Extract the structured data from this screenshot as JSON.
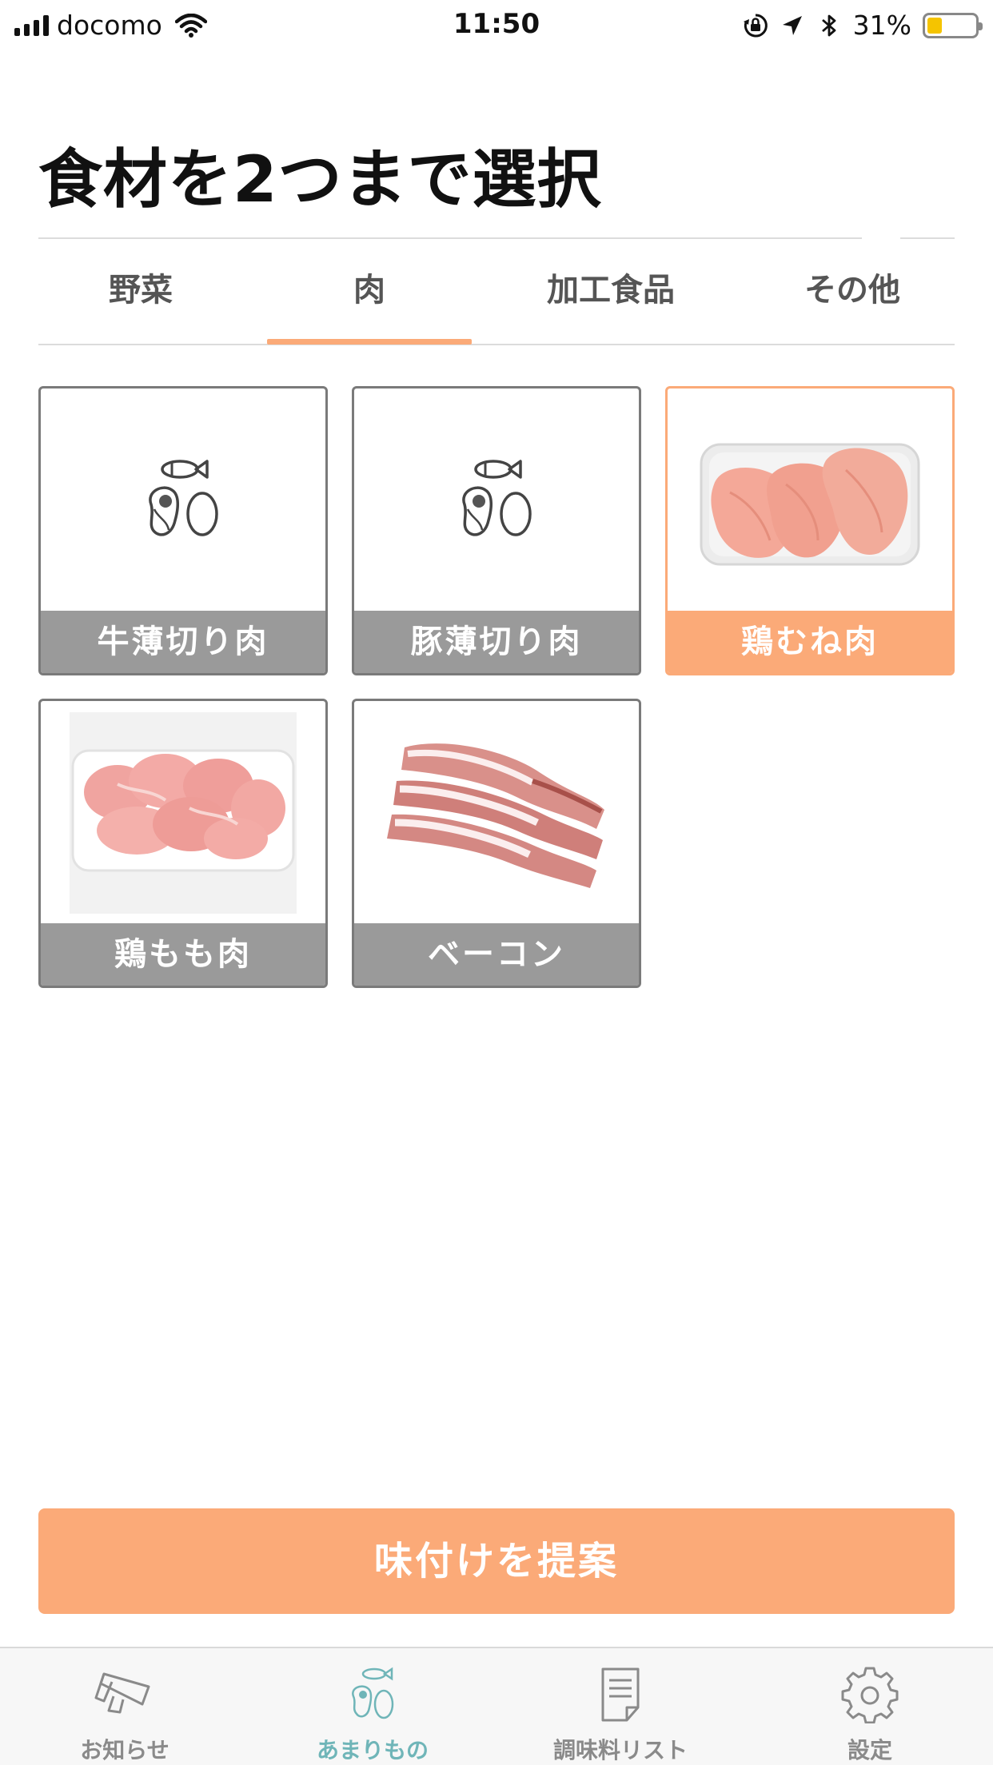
{
  "status_bar": {
    "carrier": "docomo",
    "time": "11:50",
    "battery_percent": "31%",
    "battery_level": 0.31,
    "battery_color": "#f5c400"
  },
  "page_title": "食材を2つまで選択",
  "tabs": [
    {
      "label": "野菜",
      "active": false
    },
    {
      "label": "肉",
      "active": true
    },
    {
      "label": "加工食品",
      "active": false
    },
    {
      "label": "その他",
      "active": false
    }
  ],
  "accent_color": "#fbaa78",
  "items": [
    {
      "label": "牛薄切り肉",
      "image": "placeholder-icon",
      "selected": false
    },
    {
      "label": "豚薄切り肉",
      "image": "placeholder-icon",
      "selected": false
    },
    {
      "label": "鶏むね肉",
      "image": "chicken-breast-photo",
      "selected": true
    },
    {
      "label": "鶏もも肉",
      "image": "chicken-thigh-photo",
      "selected": false
    },
    {
      "label": "ベーコン",
      "image": "bacon-photo",
      "selected": false
    }
  ],
  "suggest_button": "味付けを提案",
  "tab_bar": [
    {
      "label": "お知らせ",
      "icon": "megaphone-icon",
      "active": false
    },
    {
      "label": "あまりもの",
      "icon": "ingredients-icon",
      "active": true
    },
    {
      "label": "調味料リスト",
      "icon": "document-list-icon",
      "active": false
    },
    {
      "label": "設定",
      "icon": "gear-icon",
      "active": false
    }
  ]
}
